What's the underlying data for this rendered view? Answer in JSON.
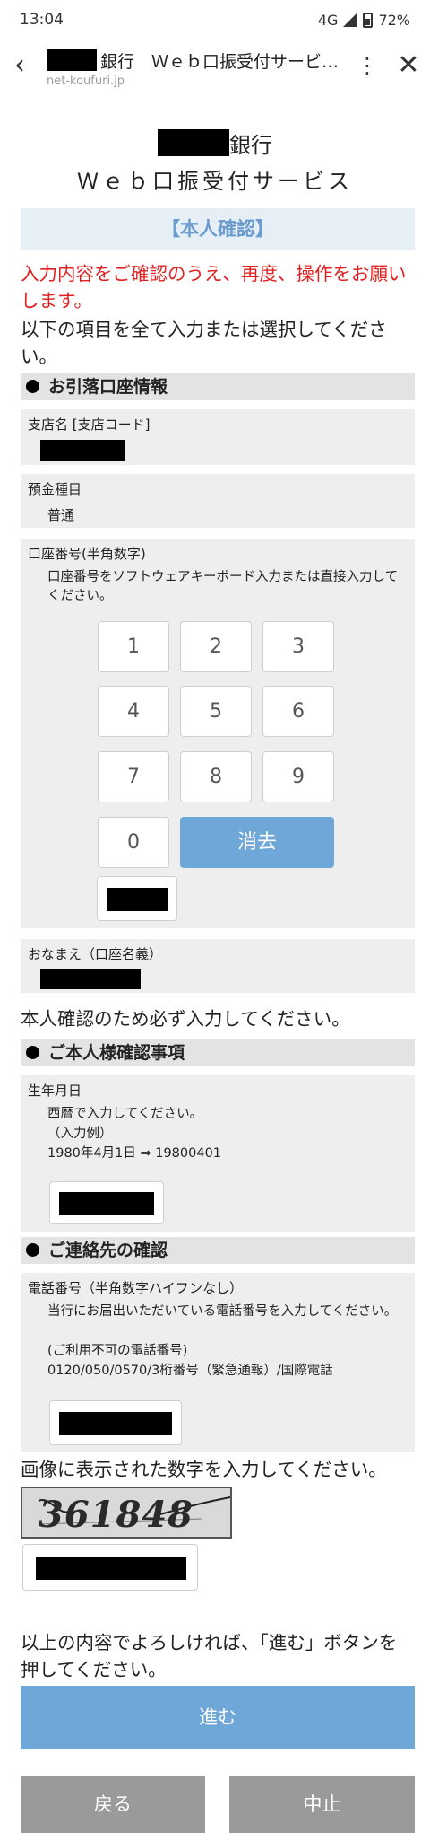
{
  "status_bar": {
    "time": "13:04",
    "network": "4G",
    "battery": "72%"
  },
  "app_bar": {
    "title": "銀行　Ｗｅｂ口振受付サービ…",
    "url": "net-koufuri.jp",
    "icons": [
      "back-arrow-icon",
      "more-vert-icon",
      "close-icon"
    ]
  },
  "header": {
    "bank_suffix": "銀行",
    "service_name": "Ｗｅｂ口振受付サービス"
  },
  "banner": "【本人確認】",
  "error_message": "入力内容をご確認のうえ、再度、操作をお願いします。",
  "instruction": "以下の項目を全て入力または選択してください。",
  "section_account": {
    "heading": "お引落口座情報",
    "branch_label": "支店名 [支店コード]",
    "deposit_type_label": "預金種目",
    "deposit_type_value": "普通",
    "account_number_label": "口座番号(半角数字)",
    "account_number_help": "口座番号をソフトウェアキーボード入力または直接入力してください。",
    "keypad": [
      "1",
      "2",
      "3",
      "4",
      "5",
      "6",
      "7",
      "8",
      "9",
      "0"
    ],
    "clear_label": "消去",
    "name_label": "おなまえ（口座名義）"
  },
  "verify_note": "本人確認のため必ず入力してください。",
  "section_identity": {
    "heading": "ご本人様確認事項",
    "birthdate_label": "生年月日",
    "birthdate_help_1": "西暦で入力してください。",
    "birthdate_help_2": "（入力例）",
    "birthdate_help_3": "1980年4月1日 ⇒ 19800401"
  },
  "section_contact": {
    "heading": "ご連絡先の確認",
    "phone_label": "電話番号（半角数字ハイフンなし）",
    "phone_help_1": "当行にお届出いただいている電話番号を入力してください。",
    "phone_help_2": "(ご利用不可の電話番号)",
    "phone_help_3": "0120/050/0570/3桁番号（緊急通報）/国際電話"
  },
  "captcha": {
    "prompt": "画像に表示された数字を入力してください。",
    "image_text": "361848"
  },
  "confirm_text": "以上の内容でよろしければ、「進む」ボタンを押してください。",
  "buttons": {
    "next": "進む",
    "back": "戻る",
    "cancel": "中止"
  },
  "colors": {
    "accent_blue": "#6fa8d8",
    "banner_text": "#6a9ccd",
    "error_red": "#e02020",
    "gray_button": "#9a9a9a"
  }
}
